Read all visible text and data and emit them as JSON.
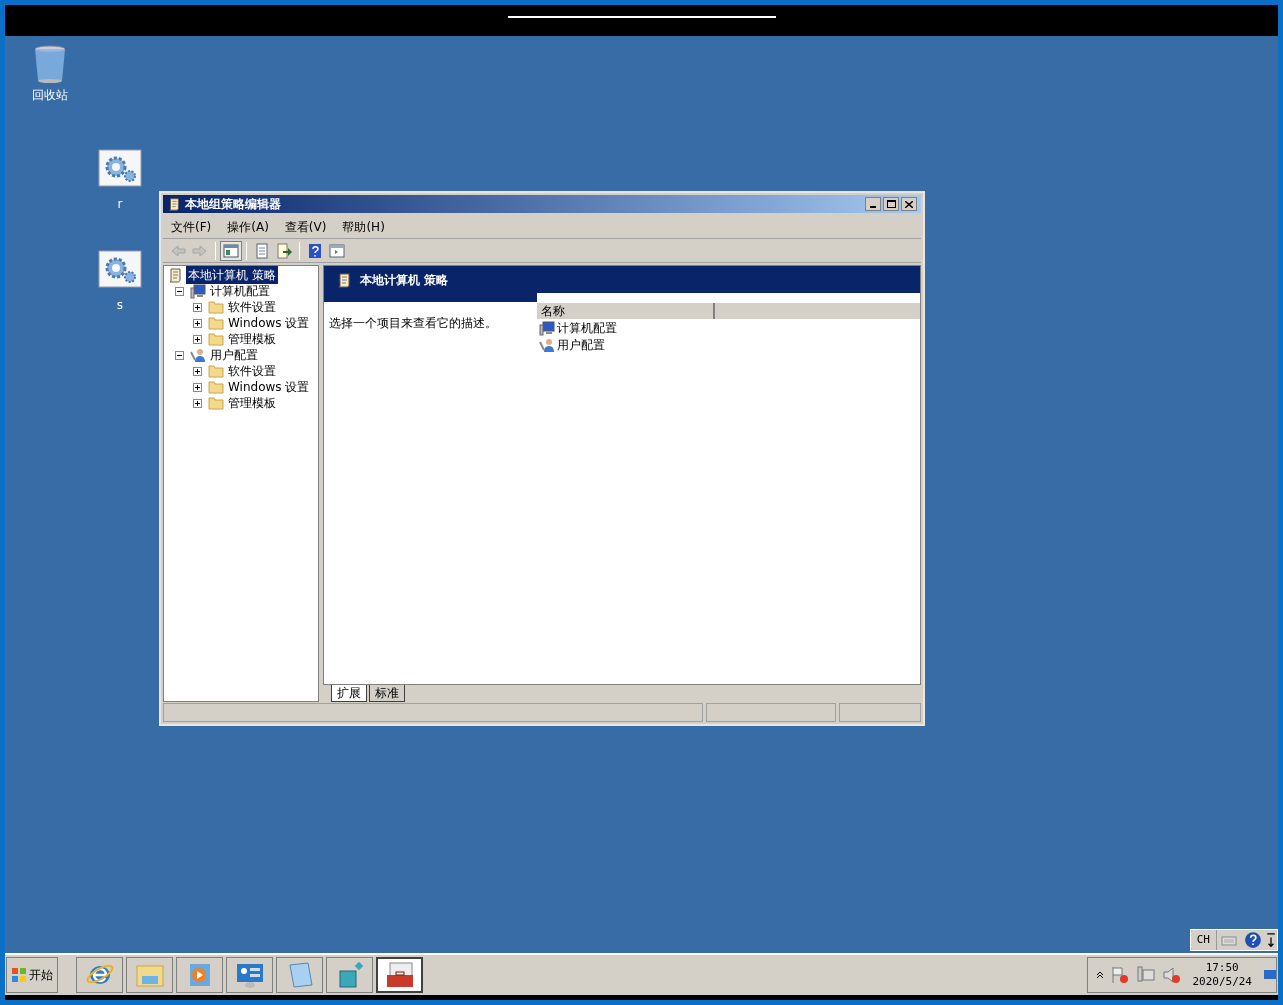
{
  "desktop_icons": [
    {
      "label": "回收站",
      "kind": "recycle-bin"
    },
    {
      "label": "r",
      "kind": "gear"
    },
    {
      "label": "s",
      "kind": "gear"
    }
  ],
  "window": {
    "title": "本地组策略编辑器",
    "menu": [
      "文件(F)",
      "操作(A)",
      "查看(V)",
      "帮助(H)"
    ],
    "toolbar": [
      {
        "kind": "back",
        "disabled": true
      },
      {
        "kind": "forward",
        "disabled": true
      },
      {
        "kind": "sep"
      },
      {
        "kind": "tree-toggle",
        "selected": true
      },
      {
        "kind": "sep"
      },
      {
        "kind": "properties",
        "disabled": false
      },
      {
        "kind": "export",
        "disabled": false
      },
      {
        "kind": "sep"
      },
      {
        "kind": "help",
        "disabled": false
      },
      {
        "kind": "panel",
        "disabled": false
      }
    ],
    "tree": {
      "label": "本地计算机 策略",
      "selected": true,
      "children": [
        {
          "label": "计算机配置",
          "kind": "computer",
          "expanded": true,
          "children": [
            {
              "label": "软件设置",
              "kind": "folder",
              "expanded": false
            },
            {
              "label": "Windows 设置",
              "kind": "folder",
              "expanded": false
            },
            {
              "label": "管理模板",
              "kind": "folder",
              "expanded": false
            }
          ]
        },
        {
          "label": "用户配置",
          "kind": "user",
          "expanded": true,
          "children": [
            {
              "label": "软件设置",
              "kind": "folder",
              "expanded": false
            },
            {
              "label": "Windows 设置",
              "kind": "folder",
              "expanded": false
            },
            {
              "label": "管理模板",
              "kind": "folder",
              "expanded": false
            }
          ]
        }
      ]
    },
    "details": {
      "header": "本地计算机 策略",
      "description": "选择一个项目来查看它的描述。",
      "columns": [
        "名称"
      ],
      "items": [
        {
          "label": "计算机配置",
          "kind": "computer"
        },
        {
          "label": "用户配置",
          "kind": "user"
        }
      ],
      "tabs": [
        {
          "label": "扩展",
          "selected": true
        },
        {
          "label": "标准",
          "selected": false
        }
      ]
    }
  },
  "taskbar": {
    "start": "开始",
    "apps": [
      {
        "kind": "ie",
        "selected": false
      },
      {
        "kind": "explorer",
        "selected": false
      },
      {
        "kind": "media",
        "selected": false
      },
      {
        "kind": "control-panel",
        "selected": false
      },
      {
        "kind": "notepad",
        "selected": false
      },
      {
        "kind": "registry",
        "selected": false
      },
      {
        "kind": "toolbox",
        "selected": true
      }
    ],
    "language": "CH",
    "time": "17:50",
    "date": "2020/5/24"
  }
}
